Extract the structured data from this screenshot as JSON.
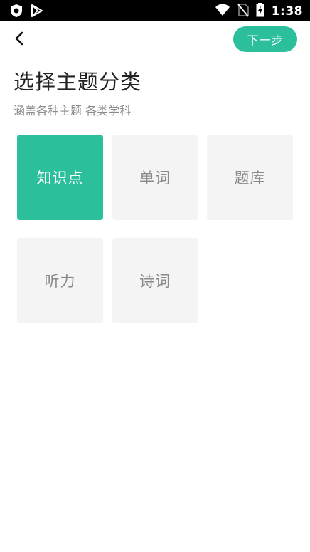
{
  "status_bar": {
    "time": "1:38",
    "left_icons": [
      "shield-app-icon",
      "play-store-icon"
    ],
    "right_icons": [
      "wifi-icon",
      "no-sim-icon",
      "battery-charging-icon"
    ]
  },
  "topbar": {
    "back_icon": "chevron-left-icon",
    "next_label": "下一步"
  },
  "header": {
    "title": "选择主题分类",
    "subtitle": "涵盖各种主题 各类学科"
  },
  "categories": [
    {
      "label": "知识点",
      "selected": true
    },
    {
      "label": "单词",
      "selected": false
    },
    {
      "label": "题库",
      "selected": false
    },
    {
      "label": "听力",
      "selected": false
    },
    {
      "label": "诗词",
      "selected": false
    }
  ],
  "colors": {
    "accent": "#2bbf9b",
    "tile_bg": "#f4f4f4",
    "tile_text": "#8a8a8a",
    "title_text": "#222222",
    "subtitle_text": "#8c8c8c"
  }
}
